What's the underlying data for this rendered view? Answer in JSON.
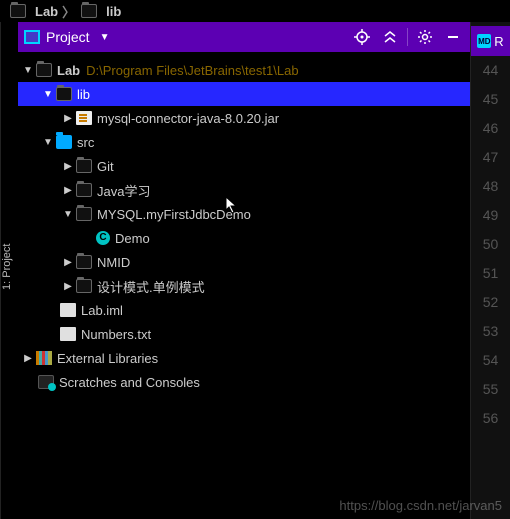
{
  "breadcrumb": {
    "root": "Lab",
    "child": "lib"
  },
  "sideTab": "1: Project",
  "toolbar": {
    "title": "Project",
    "right_label": "R"
  },
  "tree": {
    "root": {
      "name": "Lab",
      "path": "D:\\Program Files\\JetBrains\\test1\\Lab"
    },
    "lib": {
      "name": "lib"
    },
    "jar": {
      "name": "mysql-connector-java-8.0.20.jar"
    },
    "src": {
      "name": "src"
    },
    "git": {
      "name": "Git"
    },
    "java_learn": {
      "name": "Java学习"
    },
    "mysql_demo": {
      "name": "MYSQL.myFirstJdbcDemo"
    },
    "demo": {
      "name": "Demo"
    },
    "nmid": {
      "name": "NMID"
    },
    "design": {
      "name": "设计模式.单例模式"
    },
    "iml": {
      "name": "Lab.iml"
    },
    "numbers": {
      "name": "Numbers.txt"
    },
    "ext_lib": {
      "name": "External Libraries"
    },
    "scratches": {
      "name": "Scratches and Consoles"
    }
  },
  "gutter": {
    "md": "MD",
    "right": "R",
    "lines": [
      "44",
      "45",
      "46",
      "47",
      "48",
      "49",
      "50",
      "51",
      "52",
      "53",
      "54",
      "55",
      "56"
    ]
  },
  "watermark": "https://blog.csdn.net/jarvan5"
}
